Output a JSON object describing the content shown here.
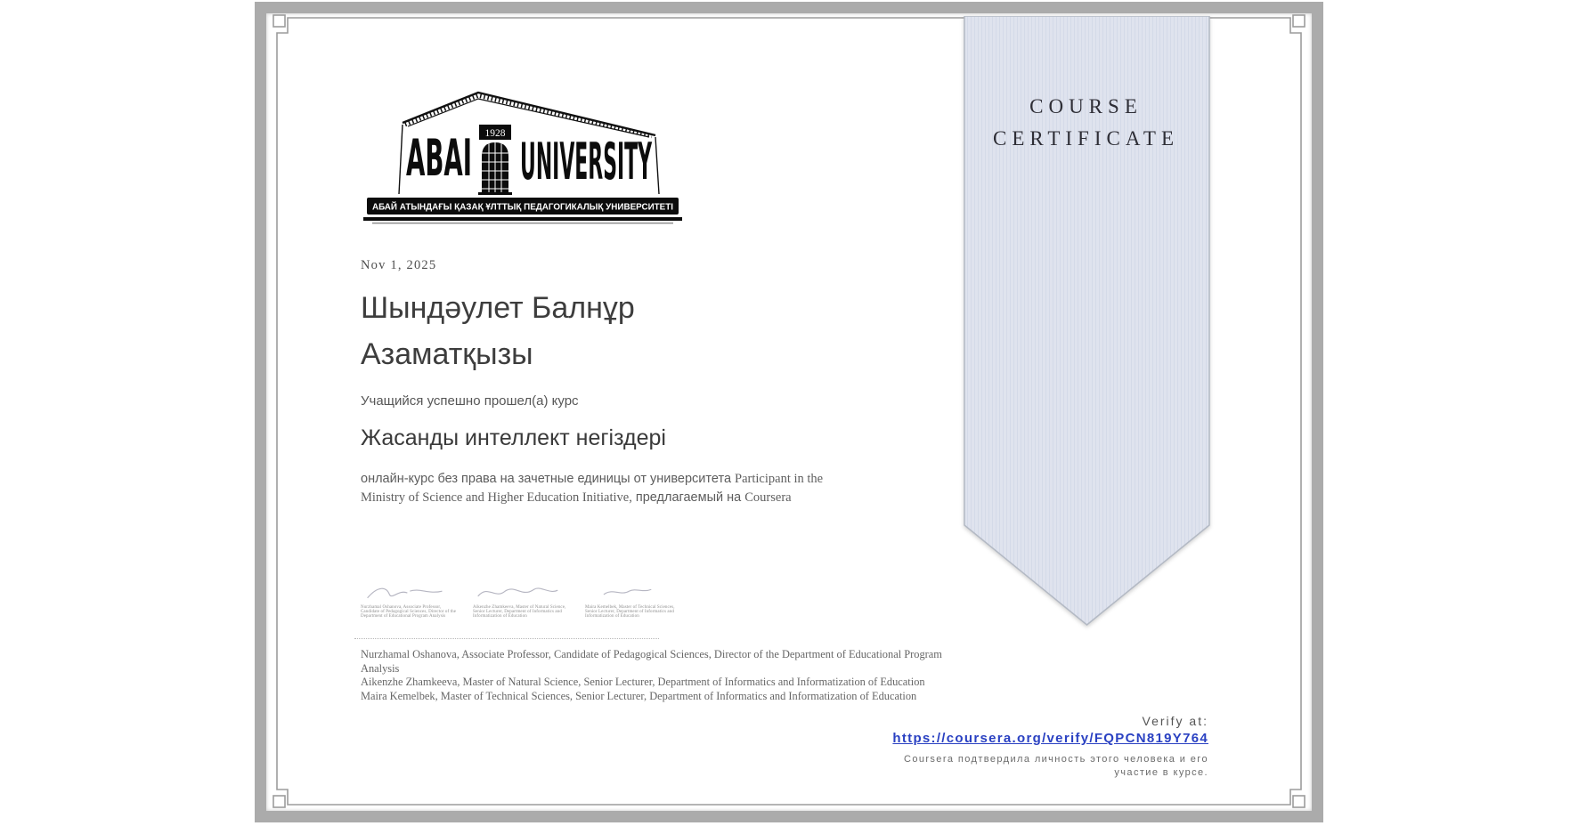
{
  "certificate": {
    "logo": {
      "word_left": "ABAI",
      "word_right": "UNIVERSITY",
      "year": "1928",
      "banner": "АБАЙ АТЫНДАҒЫ ҚАЗАҚ ҰЛТТЫҚ  ПЕДАГОГИКАЛЫҚ УНИВЕРСИТЕТІ"
    },
    "date": "Nov 1, 2025",
    "recipient_name": "Шындәулет Балнұр Азаматқызы",
    "completion_text": "Учащийся успешно прошел(а) курс",
    "course_title": "Жасанды интеллект негіздері",
    "description_segments": [
      {
        "text": "онлайн-курс без права на зачетные единицы от университета ",
        "font": "sans"
      },
      {
        "text": "Participant in the Ministry of Science and Higher Education Initiative,",
        "font": "serif"
      },
      {
        "text": " предлагаемый на ",
        "font": "sans"
      },
      {
        "text": "Coursera",
        "font": "serif"
      }
    ],
    "signers": [
      "Nurzhamal Oshanova, Associate Professor, Candidate of Pedagogical Sciences, Director of the Department of Educational Program Analysis",
      "Aikenzhe Zhamkeeva, Master of Natural Science, Senior Lecturer, Department of Informatics and Informatization of Education",
      "Maira Kemelbek, Master of Technical Sciences, Senior Lecturer, Department of Informatics and Informatization of Education"
    ]
  },
  "ribbon": {
    "line1": "COURSE",
    "line2": "CERTIFICATE"
  },
  "verify": {
    "label": "Verify at:",
    "url": "https://coursera.org/verify/FQPCN819Y764",
    "note_line1": "Coursera подтвердила личность этого человека и его",
    "note_line2": "участие в курсе."
  },
  "colors": {
    "frame_band": "#ababab",
    "frame_line": "#9c9c9c",
    "ribbon_fill": "#dfe3ee",
    "ribbon_stripe": "#d4dae8",
    "ribbon_border": "#b3b9c4",
    "link_blue": "#2a41c2"
  }
}
